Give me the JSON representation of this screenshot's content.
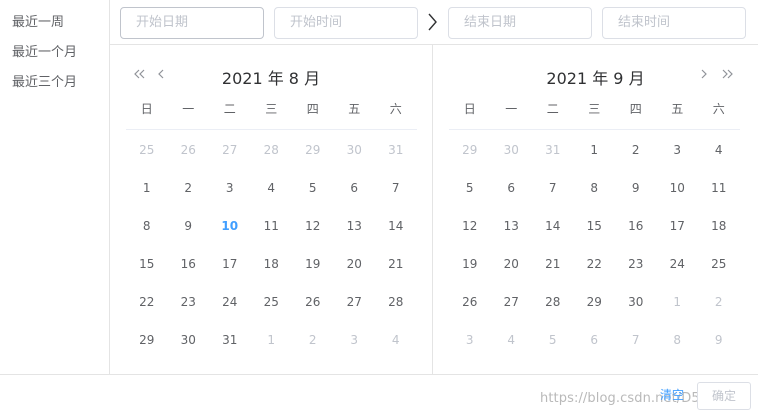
{
  "sidebar": {
    "shortcuts": [
      "最近一周",
      "最近一个月",
      "最近三个月"
    ]
  },
  "time_header": {
    "start_date_placeholder": "开始日期",
    "start_time_placeholder": "开始时间",
    "end_date_placeholder": "结束日期",
    "end_time_placeholder": "结束时间"
  },
  "weekdays": [
    "日",
    "一",
    "二",
    "三",
    "四",
    "五",
    "六"
  ],
  "left_panel": {
    "title": "2021 年 8 月",
    "weeks": [
      [
        "25",
        "26",
        "27",
        "28",
        "29",
        "30",
        "31"
      ],
      [
        "1",
        "2",
        "3",
        "4",
        "5",
        "6",
        "7"
      ],
      [
        "8",
        "9",
        "10",
        "11",
        "12",
        "13",
        "14"
      ],
      [
        "15",
        "16",
        "17",
        "18",
        "19",
        "20",
        "21"
      ],
      [
        "22",
        "23",
        "24",
        "25",
        "26",
        "27",
        "28"
      ],
      [
        "29",
        "30",
        "31",
        "1",
        "2",
        "3",
        "4"
      ]
    ],
    "other_month": [
      [
        0,
        0
      ],
      [
        0,
        1
      ],
      [
        0,
        2
      ],
      [
        0,
        3
      ],
      [
        0,
        4
      ],
      [
        0,
        5
      ],
      [
        0,
        6
      ],
      [
        5,
        3
      ],
      [
        5,
        4
      ],
      [
        5,
        5
      ],
      [
        5,
        6
      ]
    ],
    "today": [
      2,
      2
    ]
  },
  "right_panel": {
    "title": "2021 年 9 月",
    "weeks": [
      [
        "29",
        "30",
        "31",
        "1",
        "2",
        "3",
        "4"
      ],
      [
        "5",
        "6",
        "7",
        "8",
        "9",
        "10",
        "11"
      ],
      [
        "12",
        "13",
        "14",
        "15",
        "16",
        "17",
        "18"
      ],
      [
        "19",
        "20",
        "21",
        "22",
        "23",
        "24",
        "25"
      ],
      [
        "26",
        "27",
        "28",
        "29",
        "30",
        "1",
        "2"
      ],
      [
        "3",
        "4",
        "5",
        "6",
        "7",
        "8",
        "9"
      ]
    ],
    "other_month": [
      [
        0,
        0
      ],
      [
        0,
        1
      ],
      [
        0,
        2
      ],
      [
        4,
        5
      ],
      [
        4,
        6
      ],
      [
        5,
        0
      ],
      [
        5,
        1
      ],
      [
        5,
        2
      ],
      [
        5,
        3
      ],
      [
        5,
        4
      ],
      [
        5,
        5
      ],
      [
        5,
        6
      ]
    ]
  },
  "footer": {
    "clear_label": "清空",
    "confirm_label": "确定",
    "watermark": "https://blog.csdn.net/D505jw"
  },
  "colors": {
    "accent": "#409eff",
    "muted": "#c0c4cc",
    "text": "#606266"
  }
}
